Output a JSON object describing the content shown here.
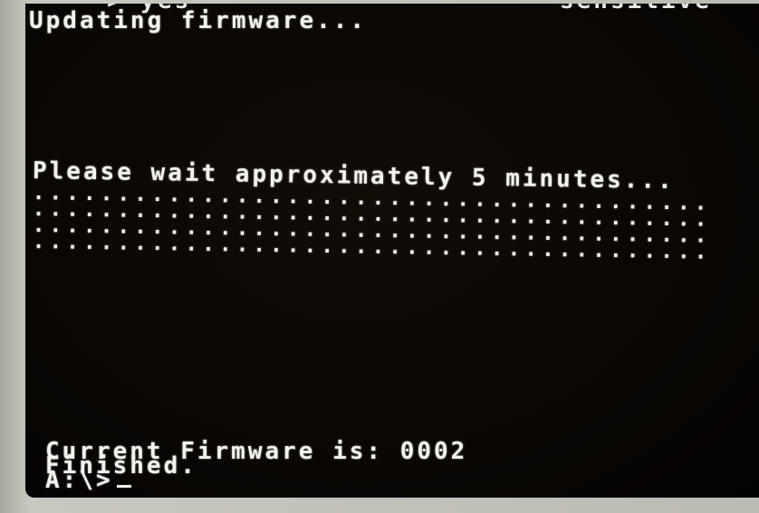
{
  "terminal": {
    "top_partial_left": "> yes",
    "top_partial_right": "sensitive",
    "line_updating": "Updating firmware...",
    "line_wait": "Please wait approximately 5 minutes...",
    "progress_rows": [
      "........................................",
      "........................................",
      "........................................",
      "........................................"
    ],
    "line_current_firmware": "Current Firmware is: 0002",
    "line_finished": "Finished.",
    "prompt": "A:\\>"
  },
  "colors": {
    "screen_bg": "#0a0704",
    "text": "#f4f2ee",
    "bezel": "#bdbcb4"
  }
}
